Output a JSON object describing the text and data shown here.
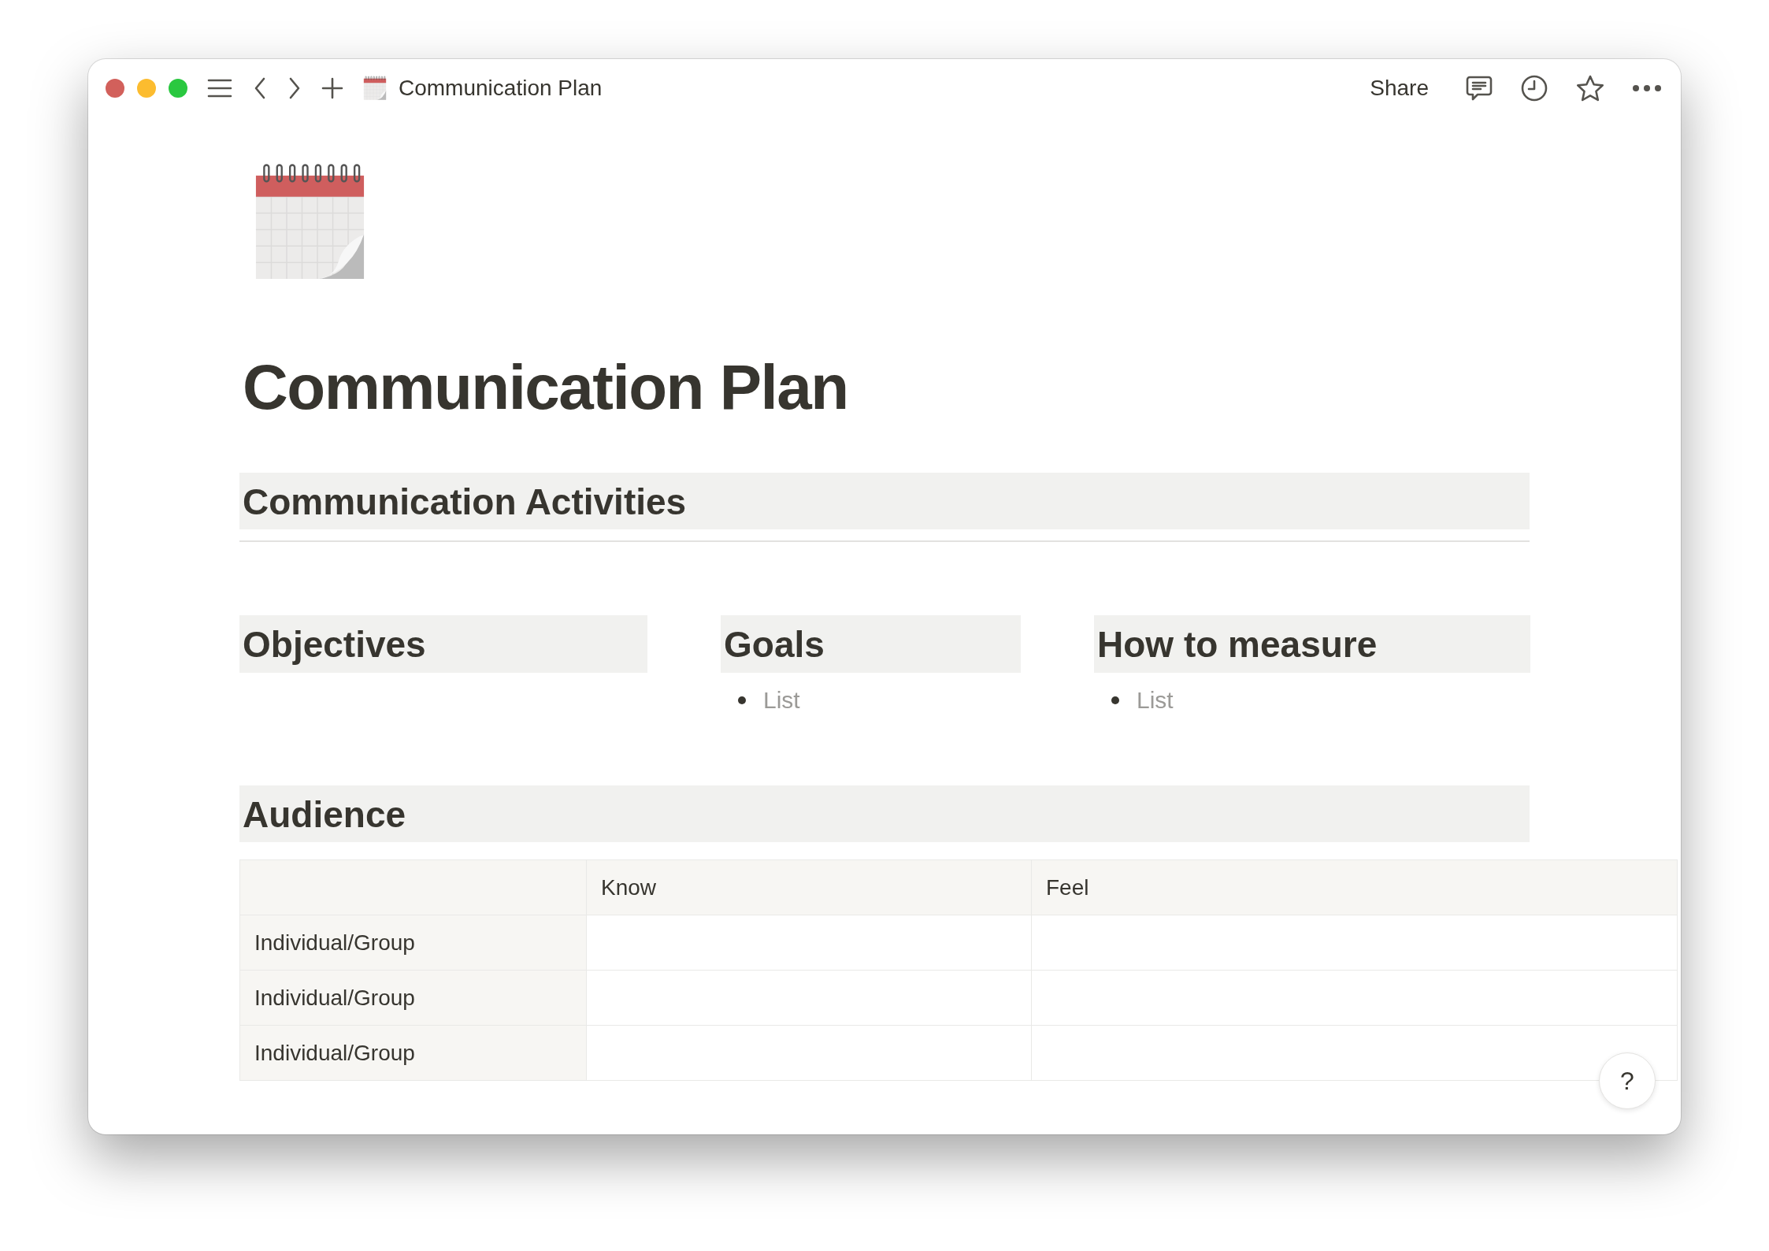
{
  "topbar": {
    "breadcrumb": "Communication Plan",
    "share": "Share"
  },
  "page": {
    "title": "Communication Plan",
    "blocks": [
      {
        "kind": "heading",
        "text": "Communication Activities",
        "divider": true
      },
      {
        "kind": "columns",
        "columns": [
          {
            "heading": "Objectives"
          },
          {
            "heading": "Goals",
            "items": [
              "List"
            ]
          },
          {
            "heading": "How to measure",
            "items": [
              "List"
            ]
          }
        ]
      },
      {
        "kind": "heading",
        "text": "Audience",
        "divider": false
      },
      {
        "kind": "table",
        "columns": [
          "Know",
          "Feel"
        ],
        "rows": [
          "Individual/Group",
          "Individual/Group",
          "Individual/Group"
        ]
      }
    ]
  },
  "help": "?"
}
